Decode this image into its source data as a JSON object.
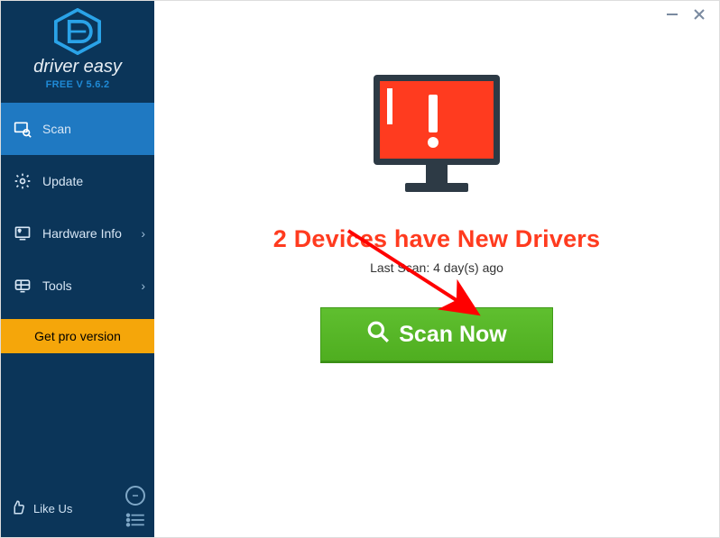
{
  "app": {
    "brand": "driver easy",
    "version_label": "FREE V 5.6.2"
  },
  "sidebar": {
    "items": [
      {
        "label": "Scan"
      },
      {
        "label": "Update"
      },
      {
        "label": "Hardware Info"
      },
      {
        "label": "Tools"
      }
    ],
    "pro_label": "Get pro version",
    "like_label": "Like Us"
  },
  "main": {
    "headline": "2 Devices have New Drivers",
    "last_scan": "Last Scan: 4 day(s) ago",
    "scan_button": "Scan Now"
  },
  "colors": {
    "accent_red": "#ff3b1f",
    "sidebar_bg": "#0b3559",
    "sidebar_active": "#1f79c2",
    "pro_bg": "#f5a60a",
    "scan_green": "#4fae20"
  }
}
